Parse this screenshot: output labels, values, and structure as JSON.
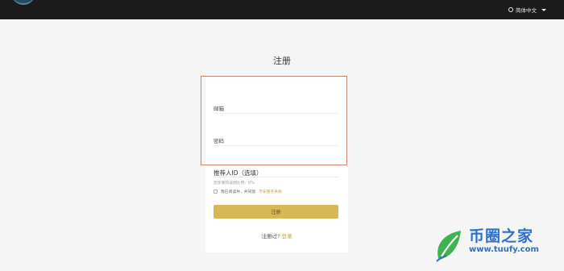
{
  "header": {
    "language_label": "简体中文",
    "icons": {
      "language": "globe-icon",
      "dropdown": "chevron-down-icon"
    }
  },
  "page": {
    "title": "注册"
  },
  "form": {
    "email_label": "邮箱",
    "password_label": "密码",
    "referrer_label": "推荐人ID（选填）",
    "commission_text": "您享受的返佣比例：0%",
    "agree_prefix": "我已阅读并，并同意",
    "agree_link": "币安服务条款",
    "submit_label": "注册"
  },
  "footer": {
    "login_prompt": "注册过?",
    "login_link": "登录"
  },
  "watermark": {
    "name": "币圈之家",
    "url": "www.tuufy.com"
  },
  "colors": {
    "topbar": "#1b1b1b",
    "accent": "#d6b955",
    "link": "#c9a43a",
    "highlight_border": "#c9836f",
    "watermark_blue": "#2e6fc9",
    "watermark_green": "#3fb34f"
  }
}
